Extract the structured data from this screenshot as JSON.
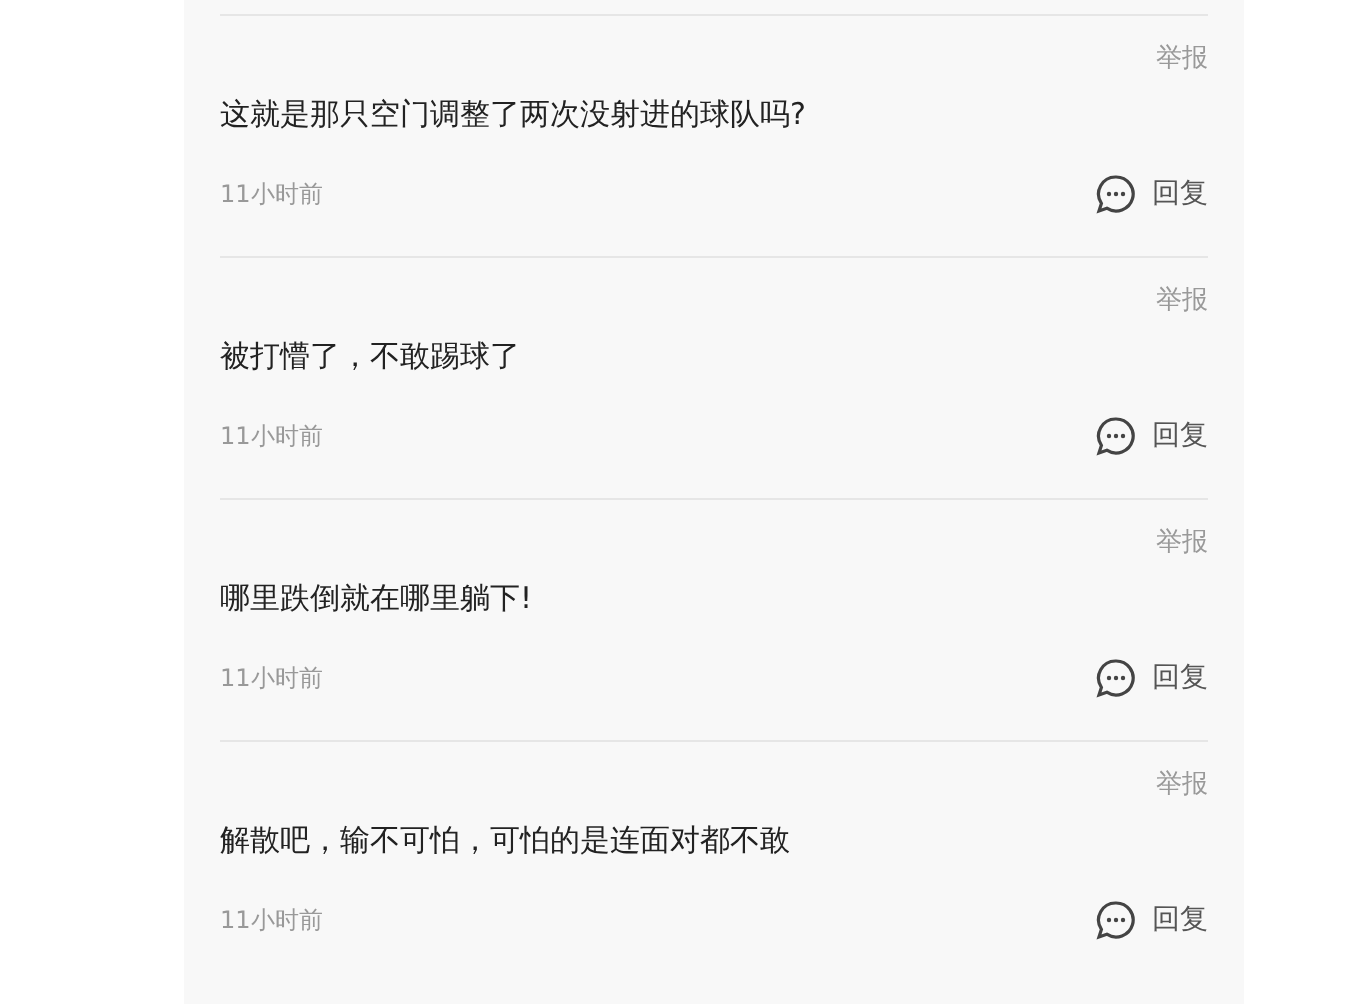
{
  "comments": [
    {
      "report": "举报",
      "text": "这就是那只空门调整了两次没射进的球队吗?",
      "time": "11小时前",
      "reply": "回复"
    },
    {
      "report": "举报",
      "text": "被打懵了，不敢踢球了",
      "time": "11小时前",
      "reply": "回复"
    },
    {
      "report": "举报",
      "text": "哪里跌倒就在哪里躺下!",
      "time": "11小时前",
      "reply": "回复"
    },
    {
      "report": "举报",
      "text": "解散吧，输不可怕，可怕的是连面对都不敢",
      "time": "11小时前",
      "reply": "回复"
    }
  ]
}
